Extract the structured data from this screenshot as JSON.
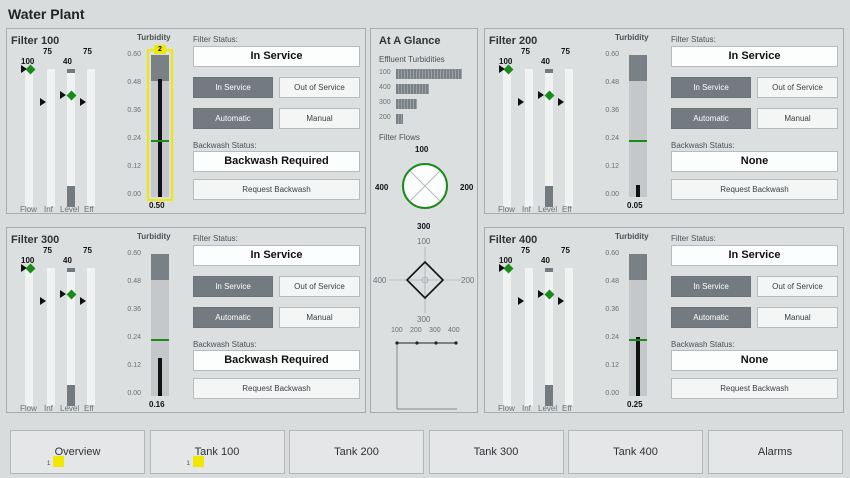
{
  "title": "Water Plant",
  "filters": [
    {
      "name": "Filter 100",
      "flow": "100",
      "infl": "75",
      "level": "40",
      "eff": "75",
      "turb_label": "Turbidity",
      "turb_value": "0.50",
      "alarm_badge": "2",
      "filter_status_label": "Filter Status:",
      "filter_status": "In Service",
      "in_service_btn": "In Service",
      "out_service_btn": "Out of Service",
      "auto_btn": "Automatic",
      "manual_btn": "Manual",
      "backwash_label": "Backwash Status:",
      "backwash_status": "Backwash Required",
      "request_btn": "Request Backwash"
    },
    {
      "name": "Filter 200",
      "flow": "100",
      "infl": "75",
      "level": "40",
      "eff": "75",
      "turb_label": "Turbidity",
      "turb_value": "0.05",
      "filter_status_label": "Filter Status:",
      "filter_status": "In Service",
      "in_service_btn": "In Service",
      "out_service_btn": "Out of Service",
      "auto_btn": "Automatic",
      "manual_btn": "Manual",
      "backwash_label": "Backwash Status:",
      "backwash_status": "None",
      "request_btn": "Request Backwash"
    },
    {
      "name": "Filter 300",
      "flow": "100",
      "infl": "75",
      "level": "40",
      "eff": "75",
      "turb_label": "Turbidity",
      "turb_value": "0.16",
      "filter_status_label": "Filter Status:",
      "filter_status": "In Service",
      "in_service_btn": "In Service",
      "out_service_btn": "Out of Service",
      "auto_btn": "Automatic",
      "manual_btn": "Manual",
      "backwash_label": "Backwash Status:",
      "backwash_status": "Backwash Required",
      "request_btn": "Request Backwash"
    },
    {
      "name": "Filter 400",
      "flow": "100",
      "infl": "75",
      "level": "40",
      "eff": "75",
      "turb_label": "Turbidity",
      "turb_value": "0.25",
      "filter_status_label": "Filter Status:",
      "filter_status": "In Service",
      "in_service_btn": "In Service",
      "out_service_btn": "Out of Service",
      "auto_btn": "Automatic",
      "manual_btn": "Manual",
      "backwash_label": "Backwash Status:",
      "backwash_status": "None",
      "request_btn": "Request Backwash"
    }
  ],
  "bar_labels": {
    "flow": "Flow",
    "inf": "Inf",
    "level": "Level",
    "eff": "Eff"
  },
  "turb_axis": [
    "0.60",
    "0.48",
    "0.36",
    "0.24",
    "0.12",
    "0.00"
  ],
  "glance": {
    "title": "At A Glance",
    "effluent_label": "Effluent Turbidities",
    "filter_flows_label": "Filter Flows",
    "bars": [
      {
        "label": "100",
        "value": 0.5
      },
      {
        "label": "400",
        "value": 0.25
      },
      {
        "label": "300",
        "value": 0.16
      },
      {
        "label": "200",
        "value": 0.05
      }
    ],
    "wheel": {
      "top": "100",
      "left": "400",
      "right": "200",
      "bottom": "300"
    },
    "diamond": {
      "top": "100",
      "left": "400",
      "right": "200",
      "bottom": "300"
    },
    "trend_ticks": [
      "100",
      "200",
      "300",
      "400"
    ]
  },
  "nav": [
    {
      "label": "Overview",
      "badge": "1"
    },
    {
      "label": "Tank 100",
      "badge": "1"
    },
    {
      "label": "Tank 200"
    },
    {
      "label": "Tank 300"
    },
    {
      "label": "Tank 400"
    },
    {
      "label": "Alarms"
    }
  ],
  "colors": {
    "active_button": "#737b80",
    "setpoint": "#1a8a1a",
    "alarm": "#f0e800"
  }
}
